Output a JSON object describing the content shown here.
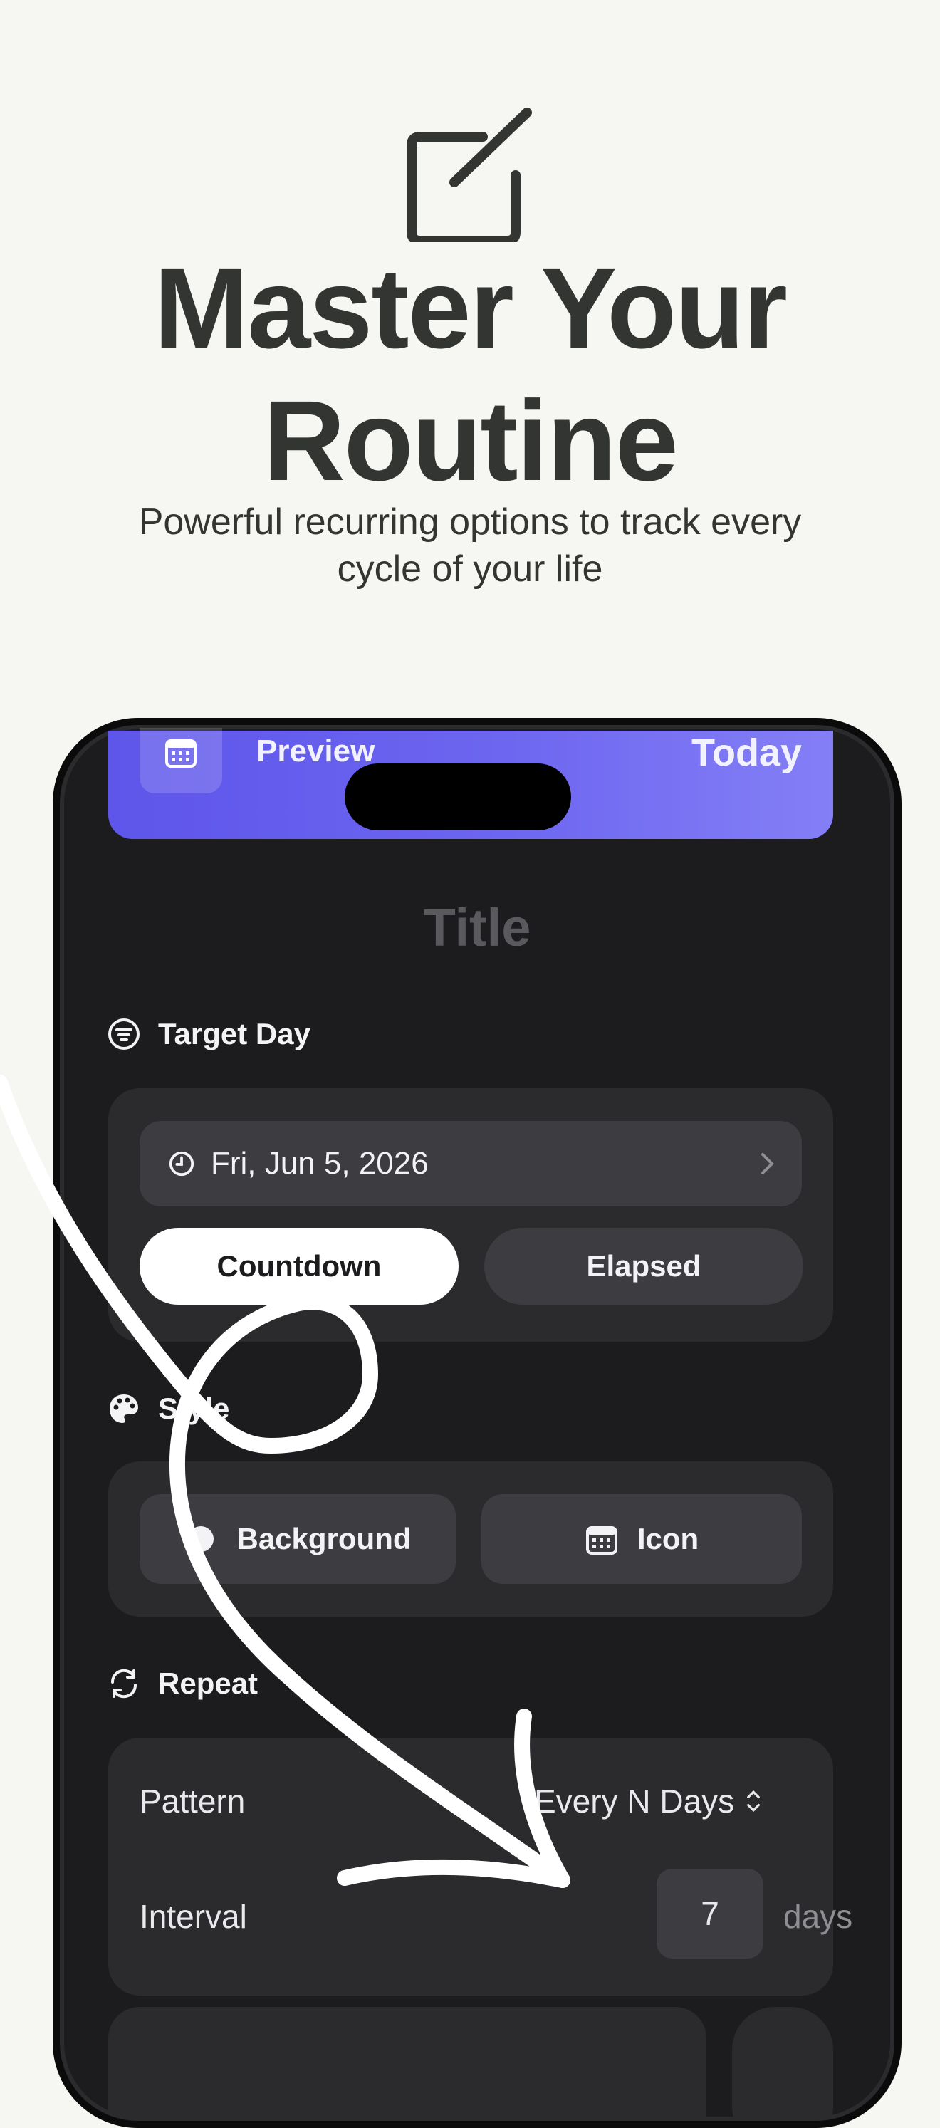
{
  "hero": {
    "icon": "edit-square-icon",
    "title_line1": "Master Your",
    "title_line2": "Routine",
    "subtitle_line1": "Powerful recurring options to track every",
    "subtitle_line2": "cycle of your life"
  },
  "phone": {
    "preview_label": "Preview",
    "today_label": "Today",
    "title_placeholder": "Title",
    "target_day": {
      "heading": "Target Day",
      "date": "Fri, Jun 5, 2026",
      "mode_countdown": "Countdown",
      "mode_elapsed": "Elapsed",
      "selected_mode": "Countdown"
    },
    "style": {
      "heading": "Style",
      "background_label": "Background",
      "icon_label": "Icon"
    },
    "repeat": {
      "heading": "Repeat",
      "pattern_label": "Pattern",
      "pattern_value": "Every N Days",
      "interval_label": "Interval",
      "interval_value": "7",
      "interval_unit": "days"
    }
  },
  "colors": {
    "page_bg": "#f6f6f2",
    "headline": "#333533",
    "phone_bg": "#1c1c1e",
    "card_bg": "#2b2b2e",
    "control_bg": "#3c3c41",
    "accent_gradient_start": "#5e55ea",
    "accent_gradient_end": "#847ff6"
  }
}
